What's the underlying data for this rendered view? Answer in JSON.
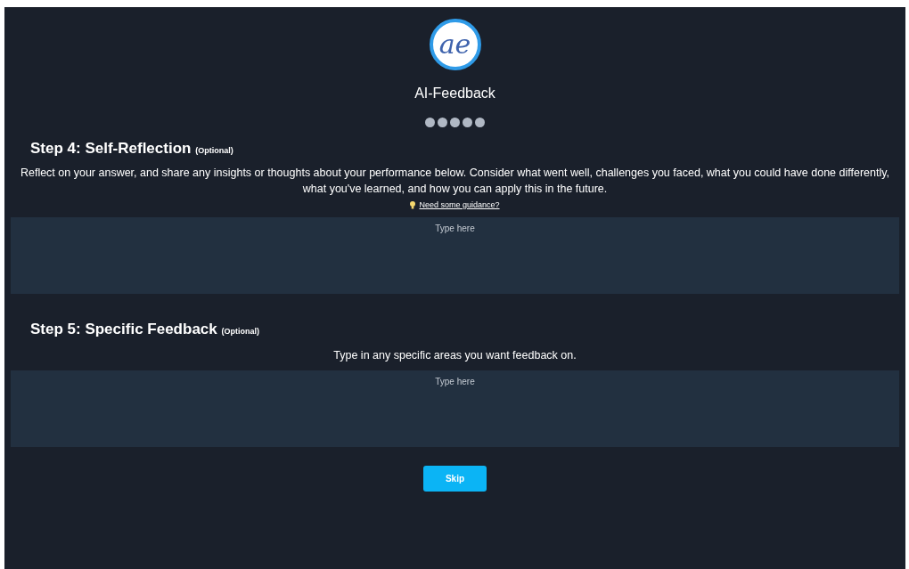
{
  "logo": {
    "text": "ae"
  },
  "app_title": "AI-Feedback",
  "progress_dots": [
    {
      "kind": "dot"
    },
    {
      "kind": "dot"
    },
    {
      "kind": "dot"
    },
    {
      "kind": "dot"
    },
    {
      "kind": "dot"
    }
  ],
  "sections": [
    {
      "title": "Step 4: Self-Reflection",
      "tag": "(Optional)",
      "description": "Reflect on your answer, and share any insights or thoughts about your performance below. Consider what went well, challenges you faced, what you could have done differently, what you've learned, and how you can apply this in the future.",
      "link": "Need some guidance?",
      "placeholder": "Type here"
    },
    {
      "title": "Step 5: Specific Feedback",
      "tag": "(Optional)",
      "description": "Type in any specific areas you want feedback on.",
      "placeholder": "Type here"
    }
  ],
  "button": "Skip"
}
